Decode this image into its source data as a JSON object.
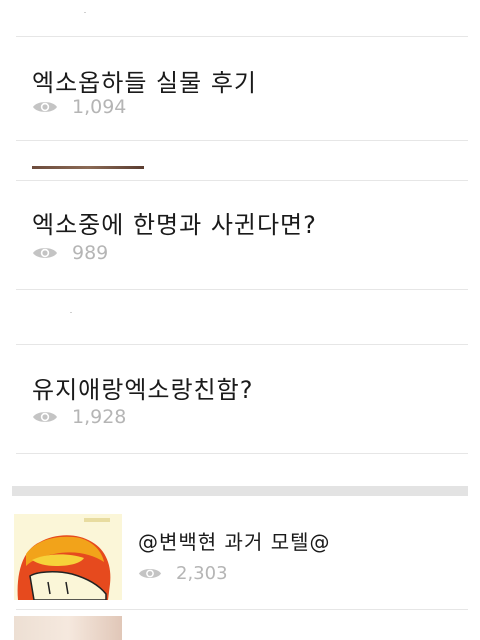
{
  "posts": [
    {
      "title": "엑소옵하들 실물 후기",
      "views": "1,094"
    },
    {
      "title": "엑소중에 한명과 사귄다면?",
      "views": "989"
    },
    {
      "title": "유지애랑엑소랑친함?",
      "views": "1,928"
    }
  ],
  "card": {
    "title": "@변백현 과거 모텔@",
    "views": "2,303"
  },
  "colors": {
    "text": "#1a1a1a",
    "meta": "#b5b5b5",
    "divider": "#e6e6e6",
    "section_band": "#e3e3e3"
  },
  "icons": {
    "views": "eye-icon"
  }
}
